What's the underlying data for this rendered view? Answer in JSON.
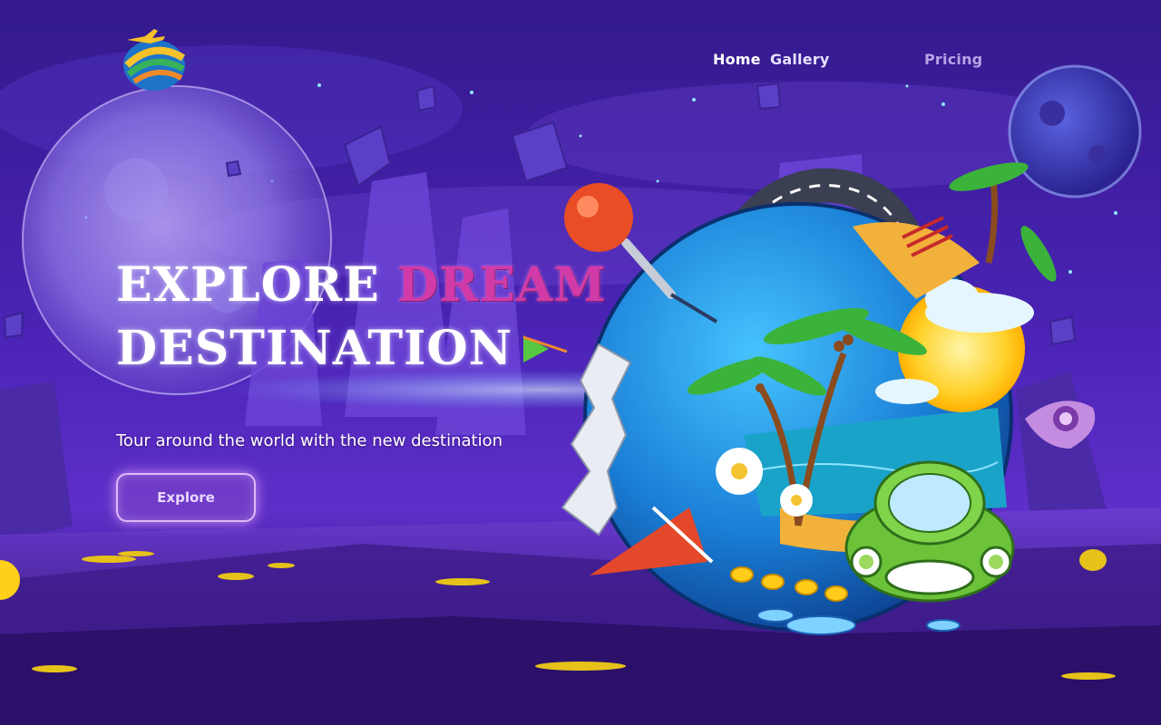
{
  "nav": {
    "items": [
      {
        "label": "Home"
      },
      {
        "label": "Gallery"
      },
      {
        "label": "Pricing"
      }
    ]
  },
  "hero": {
    "title_word_1": "EXPLORE",
    "title_word_2": "DREAM",
    "title_word_3": "DESTINATION",
    "subtitle": "Tour around the world with the new destination",
    "cta_label": "Explore"
  },
  "colors": {
    "background": "#2a0f72",
    "title_accent": "#d23aa8",
    "text": "#ffffff",
    "nav_muted": "#b8a3e6"
  },
  "icons": {
    "logo": "travel-logo-icon",
    "pin": "map-pin-icon",
    "location": "location-marker-icon"
  }
}
